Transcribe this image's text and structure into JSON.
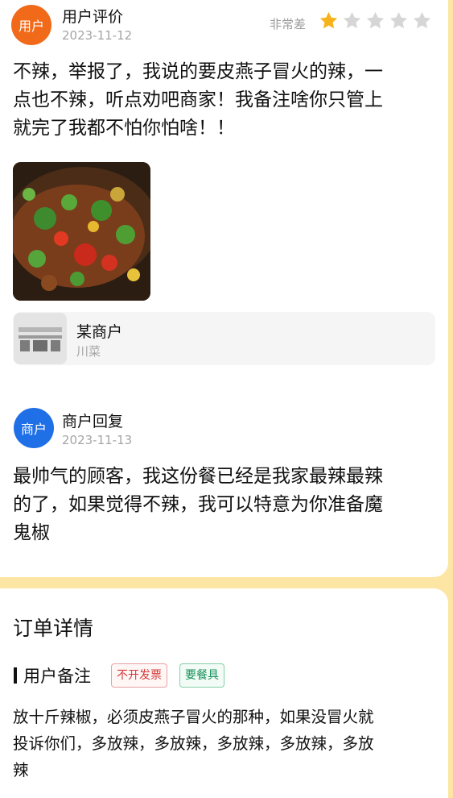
{
  "review": {
    "avatar_text": "用户",
    "title": "用户评价",
    "date": "2023-11-12",
    "rating_label": "非常差",
    "rating": 1,
    "rating_max": 5,
    "text_lines": [
      "不辣，举报了，我说的要皮燕子冒火的辣，一",
      "点也不辣，听点劝吧商家！我备注啥你只管上",
      "就完了我都不怕你怕啥！！"
    ]
  },
  "merchant_card": {
    "name": "某商户",
    "category": "川菜"
  },
  "reply": {
    "avatar_text": "商户",
    "title": "商户回复",
    "date": "2023-11-13",
    "text_lines": [
      "最帅气的顾客，我这份餐已经是我家最辣最辣",
      "的了，如果觉得不辣，我可以特意为你准备魔",
      "鬼椒"
    ]
  },
  "order": {
    "section_title": "订单详情",
    "note_title": "用户备注",
    "tags": [
      "不开发票",
      "要餐具"
    ],
    "note_lines": [
      "放十斤辣椒，必须皮燕子冒火的那种，如果没冒火就",
      "投诉你们，多放辣，多放辣，多放辣，多放辣，多放",
      "辣"
    ]
  },
  "colors": {
    "star_filled": "#f6b31b",
    "star_empty": "#d6d6d6",
    "user_avatar": "#f06a1a",
    "merchant_avatar": "#1f6fe6",
    "background": "#fde6a3"
  }
}
